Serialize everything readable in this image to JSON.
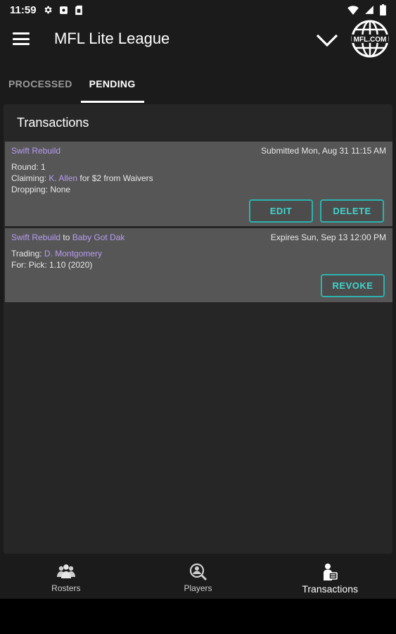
{
  "status_bar": {
    "time": "11:59",
    "left_icons": [
      "gear-icon",
      "notification-square-icon",
      "sim-card-icon"
    ],
    "right_icons": [
      "wifi-icon",
      "signal-icon",
      "battery-icon"
    ]
  },
  "app_bar": {
    "title": "MFL Lite League",
    "logo_text": "MFL.COM"
  },
  "tabs": [
    {
      "label": "PROCESSED",
      "active": false
    },
    {
      "label": "PENDING",
      "active": true
    }
  ],
  "transactions_card": {
    "title": "Transactions",
    "items": [
      {
        "team": "Swift Rebuild",
        "stamp": "Submitted Mon, Aug 31 11:15 AM",
        "round_label": "Round:",
        "round_value": "1",
        "claiming_label": "Claiming:",
        "claiming_player": "K. Allen",
        "claiming_suffix": "for $2 from Waivers",
        "dropping_label": "Dropping:",
        "dropping_value": "None",
        "buttons": [
          "EDIT",
          "DELETE"
        ]
      },
      {
        "team": "Swift Rebuild",
        "connector": "to",
        "partner": "Baby Got Dak",
        "stamp": "Expires Sun, Sep 13 12:00 PM",
        "trading_label": "Trading:",
        "trading_player": "D. Montgomery",
        "for_label": "For:",
        "for_value": "Pick: 1.10 (2020)",
        "buttons": [
          "REVOKE"
        ]
      }
    ]
  },
  "bottom_nav": [
    {
      "label": "Rosters",
      "icon": "rosters-group-icon",
      "active": false
    },
    {
      "label": "Players",
      "icon": "player-search-icon",
      "active": false
    },
    {
      "label": "Transactions",
      "icon": "transactions-person-icon",
      "active": true
    }
  ],
  "colors": {
    "accent": "#2bb3ad",
    "link": "#b79cf0",
    "background": "#1b1b1b",
    "card": "#262626",
    "transaction_row": "#565656"
  }
}
